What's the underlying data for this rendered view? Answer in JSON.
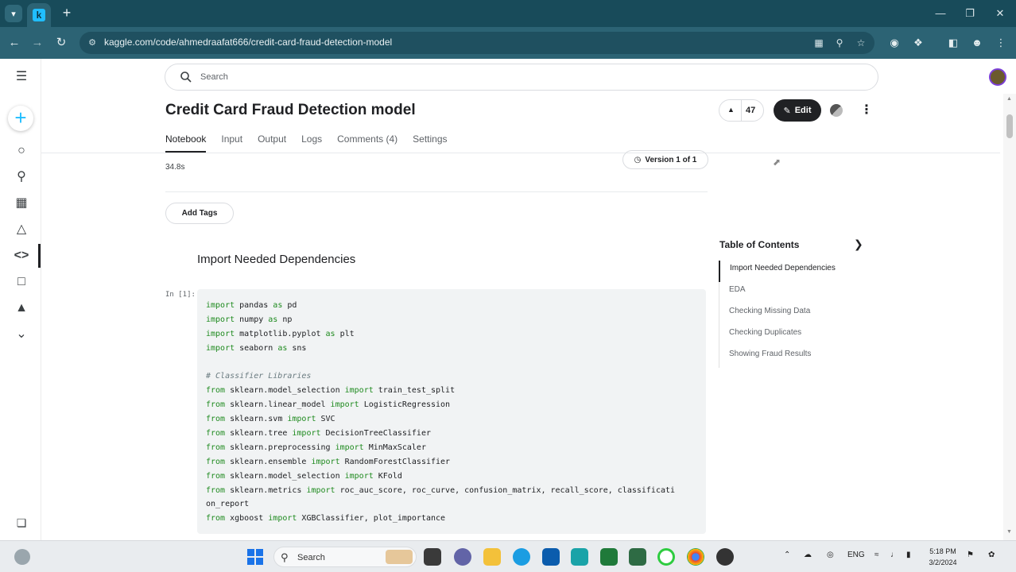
{
  "browser": {
    "tab_letter": "k",
    "url": "kaggle.com/code/ahmedraafat666/credit-card-fraud-detection-model"
  },
  "search": {
    "placeholder": "Search"
  },
  "notebook": {
    "title": "Credit Card Fraud Detection model",
    "votes": "47",
    "edit_label": "Edit",
    "tabs": [
      "Notebook",
      "Input",
      "Output",
      "Logs",
      "Comments (4)",
      "Settings"
    ],
    "run_time": "34.8s",
    "version_label": "Version 1 of 1",
    "add_tags_label": "Add Tags"
  },
  "cell": {
    "heading": "Import Needed Dependencies",
    "prompt": "In [1]:"
  },
  "toc": {
    "title": "Table of Contents",
    "items": [
      "Import Needed Dependencies",
      "EDA",
      "Checking Missing Data",
      "Checking Duplicates",
      "Showing Fraud Results"
    ]
  },
  "taskbar": {
    "search_label": "Search",
    "language": "ENG",
    "time": "5:18 PM",
    "date": "3/2/2024"
  },
  "colors": {
    "browser_dark": "#184b5a",
    "browser_bar": "#2c6374",
    "kaggle_blue": "#20beff",
    "code_keyword": "#1e8a1e",
    "code_bg": "#f1f3f4"
  }
}
